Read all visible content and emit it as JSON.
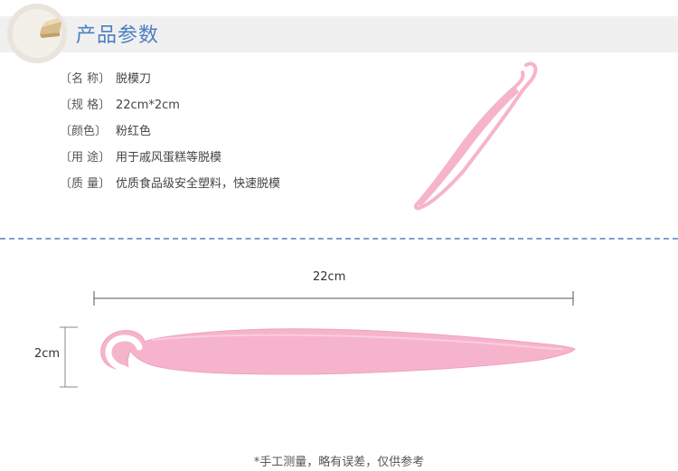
{
  "header": {
    "title": "产品参数"
  },
  "specs": [
    {
      "label": "〔名 称〕",
      "value": "脱模刀"
    },
    {
      "label": "〔规 格〕",
      "value": "22cm*2cm"
    },
    {
      "label": "〔颜色〕",
      "value": "粉红色"
    },
    {
      "label": "〔用 途〕",
      "value": "用于戚风蛋糕等脱模"
    },
    {
      "label": "〔质 量〕",
      "value": "优质食品级安全塑料，快速脱模"
    }
  ],
  "dimensions": {
    "width_label": "22cm",
    "height_label": "2cm"
  },
  "footnote": "*手工测量，略有误差，仅供参考",
  "colors": {
    "title": "#4a7fc1",
    "tool_pink": "#f6b4cc",
    "divider": "#7f9fcf",
    "header_band": "#f0f0f0"
  },
  "icons": [
    "plate-with-cake-icon"
  ]
}
